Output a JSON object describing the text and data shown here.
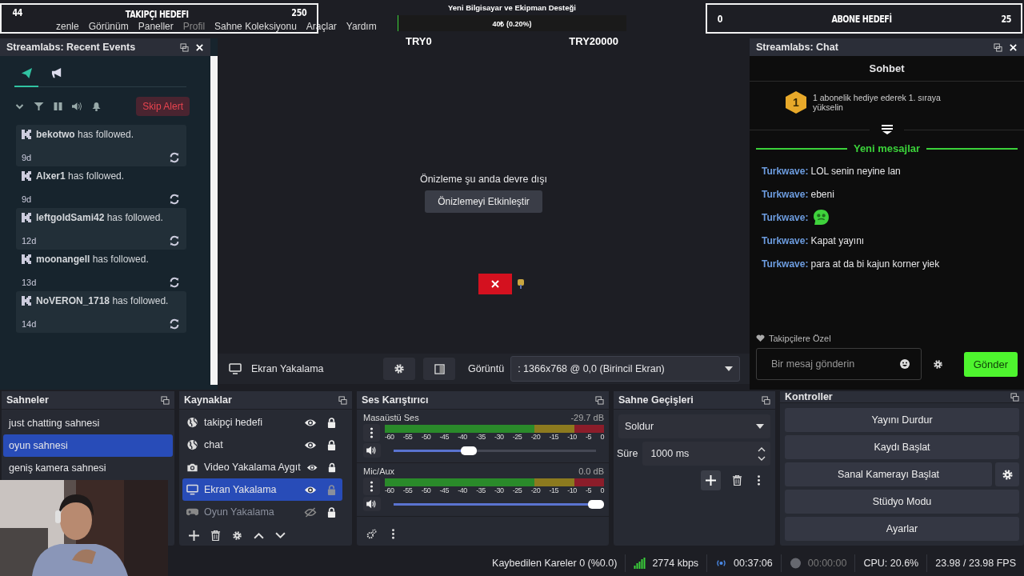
{
  "menu": [
    "zenle",
    "Görünüm",
    "Paneller",
    "Profil",
    "Sahne Koleksiyonu",
    "Araçlar",
    "Yardım"
  ],
  "follower_goal": {
    "current": "44",
    "title": "TAKIPÇI HEDEFI",
    "target": "250"
  },
  "donation_goal": {
    "title": "Yeni Bilgisayar ve Ekipman Desteği",
    "progress": "40₺ (0.20%)",
    "level": 0.002,
    "start": "TRY0",
    "end": "TRY20000"
  },
  "subscriber_goal": {
    "current": "0",
    "title": "ABONE HEDEFİ",
    "target": "25"
  },
  "recent_events": {
    "title": "Streamlabs: Recent Events",
    "tabs": [
      {
        "kind": "plane",
        "selected": true
      },
      {
        "kind": "megaphone",
        "selected": false
      }
    ],
    "skip_button": "Skip Alert",
    "events": [
      {
        "text": "**bekotwo** has followed.",
        "time": "9d"
      },
      {
        "text": "**Alxer1** has followed.",
        "time": "9d"
      },
      {
        "text": "**leftgoldSami42** has followed.",
        "time": "12d"
      },
      {
        "text": "**moonangell** has followed.",
        "time": "13d"
      },
      {
        "text": "**NoVERON_1718** has followed.",
        "time": "14d"
      }
    ]
  },
  "preview": {
    "message": "Önizleme şu anda devre dışı",
    "enable_button": "Önizlemeyi Etkinleştir"
  },
  "source_toolbar": {
    "source": "Ekran Yakalama",
    "display_label": "Görüntü",
    "display_value": ": 1366x768 @ 0,0 (Birincil Ekran)"
  },
  "chat": {
    "title": "Streamlabs: Chat",
    "heading": "Sohbet",
    "rank_badge": "1",
    "rank_text": "1 abonelik hediye ederek 1. sıraya yükselin",
    "new_messages": "Yeni mesajlar",
    "messages": [
      {
        "kind": "text",
        "user": "Turkwave:",
        "text": "LOL senin neyine lan"
      },
      {
        "kind": "text",
        "user": "Turkwave:",
        "text": "ebeni"
      },
      {
        "kind": "emote",
        "user": "Turkwave:"
      },
      {
        "kind": "text",
        "user": "Turkwave:",
        "text": "Kapat yayını"
      },
      {
        "kind": "text",
        "user": "Turkwave:",
        "text": "para at da bi kajun korner yiek"
      }
    ],
    "mode": "Takipçilere Özel",
    "placeholder": "Bir mesaj gönderin",
    "send_button": "Gönder"
  },
  "scenes": {
    "title": "Sahneler",
    "items": [
      {
        "name": "just chatting sahnesi",
        "selected": false
      },
      {
        "name": "oyun sahnesi",
        "selected": true
      },
      {
        "name": "geniş kamera sahnesi",
        "selected": false
      }
    ]
  },
  "sources": {
    "title": "Kaynaklar",
    "items": [
      {
        "kind": "globe",
        "name": "takipçi hedefi",
        "visible": true,
        "locked": true,
        "selected": false
      },
      {
        "kind": "globe",
        "name": "chat",
        "visible": true,
        "locked": true,
        "selected": false
      },
      {
        "kind": "camera",
        "name": "Video Yakalama Aygıt",
        "visible": true,
        "locked": true,
        "selected": false
      },
      {
        "kind": "monitor",
        "name": "Ekran Yakalama",
        "visible": true,
        "locked": false,
        "selected": true
      },
      {
        "kind": "gamepad",
        "name": "Oyun Yakalama",
        "visible": false,
        "locked": true,
        "selected": false
      }
    ]
  },
  "mixer": {
    "title": "Ses Karıştırıcı",
    "channels": [
      {
        "name": "Masaüstü Ses",
        "reading": "-29.7 dB",
        "level": 0.37,
        "ticks": [
          "-60",
          "-55",
          "-50",
          "-45",
          "-40",
          "-35",
          "-30",
          "-25",
          "-20",
          "-15",
          "-10",
          "-5",
          "0"
        ]
      },
      {
        "name": "Mic/Aux",
        "reading": "0.0 dB",
        "level": 1.0,
        "ticks": [
          "-60",
          "-55",
          "-50",
          "-45",
          "-40",
          "-35",
          "-30",
          "-25",
          "-20",
          "-15",
          "-10",
          "-5",
          "0"
        ]
      }
    ]
  },
  "transitions": {
    "title": "Sahne Geçişleri",
    "transition": "Soldur",
    "duration_label": "Süre",
    "duration": "1000 ms"
  },
  "controls": {
    "title": "Kontroller",
    "buttons": [
      {
        "label": "Yayını Durdur",
        "settings": false
      },
      {
        "label": "Kaydı Başlat",
        "settings": false
      },
      {
        "label": "Sanal Kamerayı Başlat",
        "settings": true
      },
      {
        "label": "Stüdyo Modu",
        "settings": false
      },
      {
        "label": "Ayarlar",
        "settings": false
      }
    ]
  },
  "status_bar": {
    "dropped_frames": "Kaybedilen Kareler 0 (%0.0)",
    "bitrate": "2774 kbps",
    "stream_time": "00:37:06",
    "record_time": "00:00:00",
    "cpu": "CPU: 20.6%",
    "fps": "23.98 / 23.98 FPS"
  }
}
